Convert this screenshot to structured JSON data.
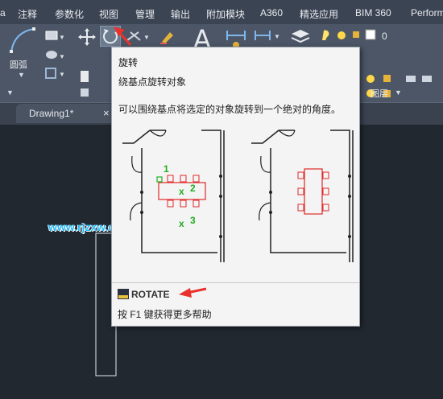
{
  "menu": {
    "items": [
      "注释",
      "参数化",
      "视图",
      "管理",
      "输出",
      "附加模块",
      "A360",
      "精选应用",
      "BIM 360",
      "Perform"
    ]
  },
  "ribbon": {
    "arc_label": "圆弧",
    "layers_label": "图层",
    "layer_value": "0"
  },
  "file_tab": {
    "title": "Drawing1*",
    "close": "×"
  },
  "tooltip": {
    "title": "旋转",
    "subtitle": "绕基点旋转对象",
    "description": "可以围绕基点将选定的对象旋转到一个绝对的角度。",
    "steps": [
      "1",
      "2",
      "3"
    ],
    "command": "ROTATE",
    "help": "按 F1 键获得更多帮助"
  },
  "watermark": "www.rjzxw.com",
  "colors": {
    "menubar": "#3b4453",
    "ribbon": "#4c5666",
    "canvas": "#212830",
    "tooltip_bg": "#f4f4f4",
    "annotation_arrow": "#e8322c",
    "step_green": "#1fae1f",
    "watermark": "#26b7f2"
  }
}
